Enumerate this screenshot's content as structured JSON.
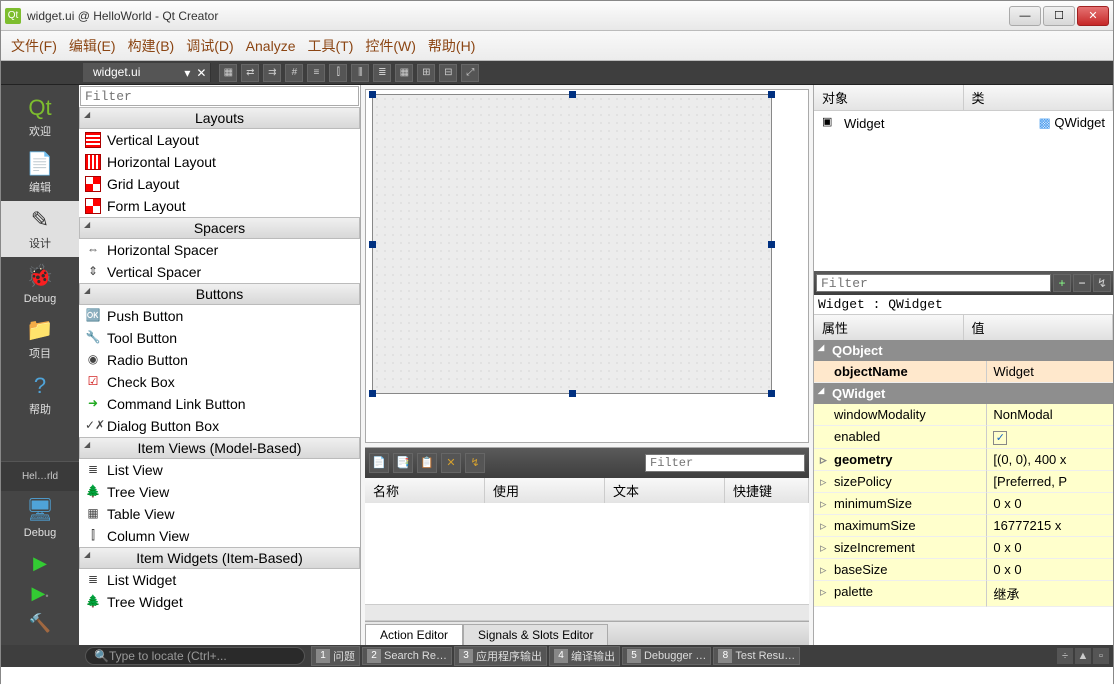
{
  "window": {
    "title": "widget.ui @ HelloWorld - Qt Creator"
  },
  "menu": [
    "文件(F)",
    "编辑(E)",
    "构建(B)",
    "调试(D)",
    "Analyze",
    "工具(T)",
    "控件(W)",
    "帮助(H)"
  ],
  "doc_tab": "widget.ui",
  "modes": [
    {
      "label": "欢迎"
    },
    {
      "label": "编辑"
    },
    {
      "label": "设计"
    },
    {
      "label": "Debug"
    },
    {
      "label": "项目"
    },
    {
      "label": "帮助"
    }
  ],
  "project_kit": "Hel…rld",
  "debug_label": "Debug",
  "widgetbox": {
    "filter_placeholder": "Filter",
    "categories": [
      {
        "name": "Layouts",
        "items": [
          "Vertical Layout",
          "Horizontal Layout",
          "Grid Layout",
          "Form Layout"
        ]
      },
      {
        "name": "Spacers",
        "items": [
          "Horizontal Spacer",
          "Vertical Spacer"
        ]
      },
      {
        "name": "Buttons",
        "items": [
          "Push Button",
          "Tool Button",
          "Radio Button",
          "Check Box",
          "Command Link Button",
          "Dialog Button Box"
        ]
      },
      {
        "name": "Item Views (Model-Based)",
        "items": [
          "List View",
          "Tree View",
          "Table View",
          "Column View"
        ]
      },
      {
        "name": "Item Widgets (Item-Based)",
        "items": [
          "List Widget",
          "Tree Widget"
        ]
      }
    ]
  },
  "object_inspector": {
    "cols": [
      "对象",
      "类"
    ],
    "row": {
      "name": "Widget",
      "cls": "QWidget"
    }
  },
  "prop_editor": {
    "filter_placeholder": "Filter",
    "info": "Widget : QWidget",
    "cols": [
      "属性",
      "值"
    ],
    "rows": [
      {
        "type": "group",
        "label": "QObject"
      },
      {
        "k": "objectName",
        "v": "Widget",
        "style": "pink",
        "bold": true
      },
      {
        "type": "group",
        "label": "QWidget"
      },
      {
        "k": "windowModality",
        "v": "NonModal",
        "style": "yellow"
      },
      {
        "k": "enabled",
        "v": "[check]",
        "style": "yellow"
      },
      {
        "k": "geometry",
        "v": "[(0, 0), 400 x",
        "style": "yellow",
        "exp": true,
        "bold": true
      },
      {
        "k": "sizePolicy",
        "v": "[Preferred, P",
        "style": "yellow",
        "exp": true
      },
      {
        "k": "minimumSize",
        "v": "0 x 0",
        "style": "yellow",
        "exp": true
      },
      {
        "k": "maximumSize",
        "v": "16777215 x",
        "style": "yellow",
        "exp": true
      },
      {
        "k": "sizeIncrement",
        "v": "0 x 0",
        "style": "yellow",
        "exp": true
      },
      {
        "k": "baseSize",
        "v": "0 x 0",
        "style": "yellow",
        "exp": true
      },
      {
        "k": "palette",
        "v": "继承",
        "style": "yellow",
        "exp": true
      }
    ]
  },
  "action_editor": {
    "filter_placeholder": "Filter",
    "cols": [
      "名称",
      "使用",
      "文本",
      "快捷键"
    ],
    "tabs": [
      "Action Editor",
      "Signals & Slots Editor"
    ]
  },
  "output_tabs": [
    {
      "n": "1",
      "label": "问题"
    },
    {
      "n": "2",
      "label": "Search Re…"
    },
    {
      "n": "3",
      "label": "应用程序输出"
    },
    {
      "n": "4",
      "label": "编译输出"
    },
    {
      "n": "5",
      "label": "Debugger …"
    },
    {
      "n": "8",
      "label": "Test Resu…"
    }
  ],
  "locator_placeholder": "Type to locate (Ctrl+..."
}
